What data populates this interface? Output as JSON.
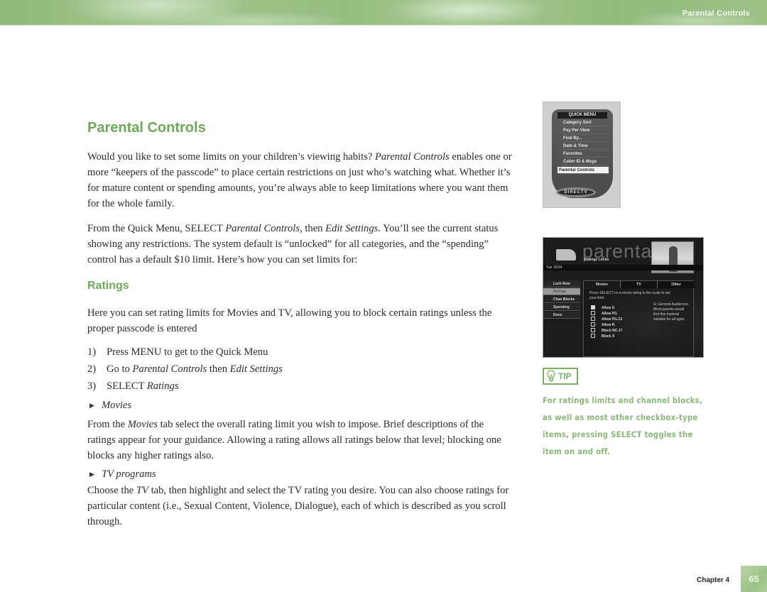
{
  "header": {
    "running_title": "Parental Controls"
  },
  "page_title": "Parental Controls",
  "intro": {
    "p1_a": "Would you like to set some limits on your children’s viewing habits? ",
    "p1_em": "Parental Controls",
    "p1_b": " enables one or more “keepers of the passcode” to place certain restrictions on just who’s watching what. Whether it’s for mature content or spending amounts, you’re always able to keep limitations where you want them for the whole family.",
    "p2_a": "From the Quick Menu, SELECT ",
    "p2_em1": "Parental Controls,",
    "p2_b": " then ",
    "p2_em2": "Edit Settings",
    "p2_c": ". You’ll see the current status showing any restrictions. The system default is “unlocked” for all categories, and the “spending” control has a default $10 limit. Here’s how you can set limits for:"
  },
  "ratings": {
    "title": "Ratings",
    "intro": "Here you can set rating limits for Movies and TV, allowing you to block certain ratings unless the proper passcode is entered",
    "steps": [
      {
        "num": "1)",
        "text_a": "Press MENU to get to the Quick Menu",
        "em1": "",
        "text_b": "",
        "em2": ""
      },
      {
        "num": "2)",
        "text_a": "Go to ",
        "em1": "Parental Controls",
        "text_b": " then ",
        "em2": "Edit Settings"
      },
      {
        "num": "3)",
        "text_a": "SELECT ",
        "em1": "Ratings",
        "text_b": "",
        "em2": ""
      }
    ],
    "movies": {
      "bullet": "Movies",
      "p_a": "From the ",
      "p_em": "Movies",
      "p_b": " tab select the overall rating limit you wish to impose. Brief descriptions of the ratings appear for your guidance. Allowing a rating allows all ratings below that level; blocking one blocks any higher ratings also."
    },
    "tv": {
      "bullet": "TV programs",
      "p_a": "Choose the ",
      "p_em": "TV",
      "p_b": " tab, then highlight and select the TV rating you desire. You can also choose ratings for particular content (i.e., Sexual Content, Violence, Dialogue), each of which is described as you scroll through."
    }
  },
  "quick_menu_screenshot": {
    "header": "QUICK MENU",
    "items": [
      "Category Sort",
      "Pay Per View",
      "Find By...",
      "Date & Time",
      "Favorites",
      "Caller ID & Msgs",
      "Parental Controls"
    ],
    "selected": "Parental Controls",
    "logo": "DIRECTV"
  },
  "parental_screenshot": {
    "wordmark": "parental",
    "subtitle": "Ratings Limits",
    "date": "Tue 10/14",
    "side_menu": [
      "Lock Now",
      "Ratings",
      "Chan Blocks",
      "Spending",
      "Done"
    ],
    "selected_side": "Ratings",
    "tabs": [
      "Movies",
      "TV",
      "Other"
    ],
    "instruction": "Press SELECT on a movie rating in the scale to set your limit.",
    "rating_rows": [
      {
        "label": "Allow G",
        "checked": true
      },
      {
        "label": "Allow PG",
        "checked": false
      },
      {
        "label": "Allow PG-13",
        "checked": false
      },
      {
        "label": "Allow R",
        "checked": false
      },
      {
        "label": "Block NC-17",
        "checked": false
      },
      {
        "label": "Block X",
        "checked": false
      }
    ],
    "description": "G: General Audiences. Most parents would find this material suitable for all ages."
  },
  "tip": {
    "label": "TIP",
    "icon": "lightbulb-icon",
    "text": "For ratings limits and channel blocks, as well as most other checkbox-type items, pressing SELECT toggles the item on and off."
  },
  "footer": {
    "chapter": "Chapter 4",
    "page": "65"
  },
  "colors": {
    "accent_green": "#6ea85a",
    "tip_green": "#8ab878",
    "header_green": "#9cc187"
  }
}
